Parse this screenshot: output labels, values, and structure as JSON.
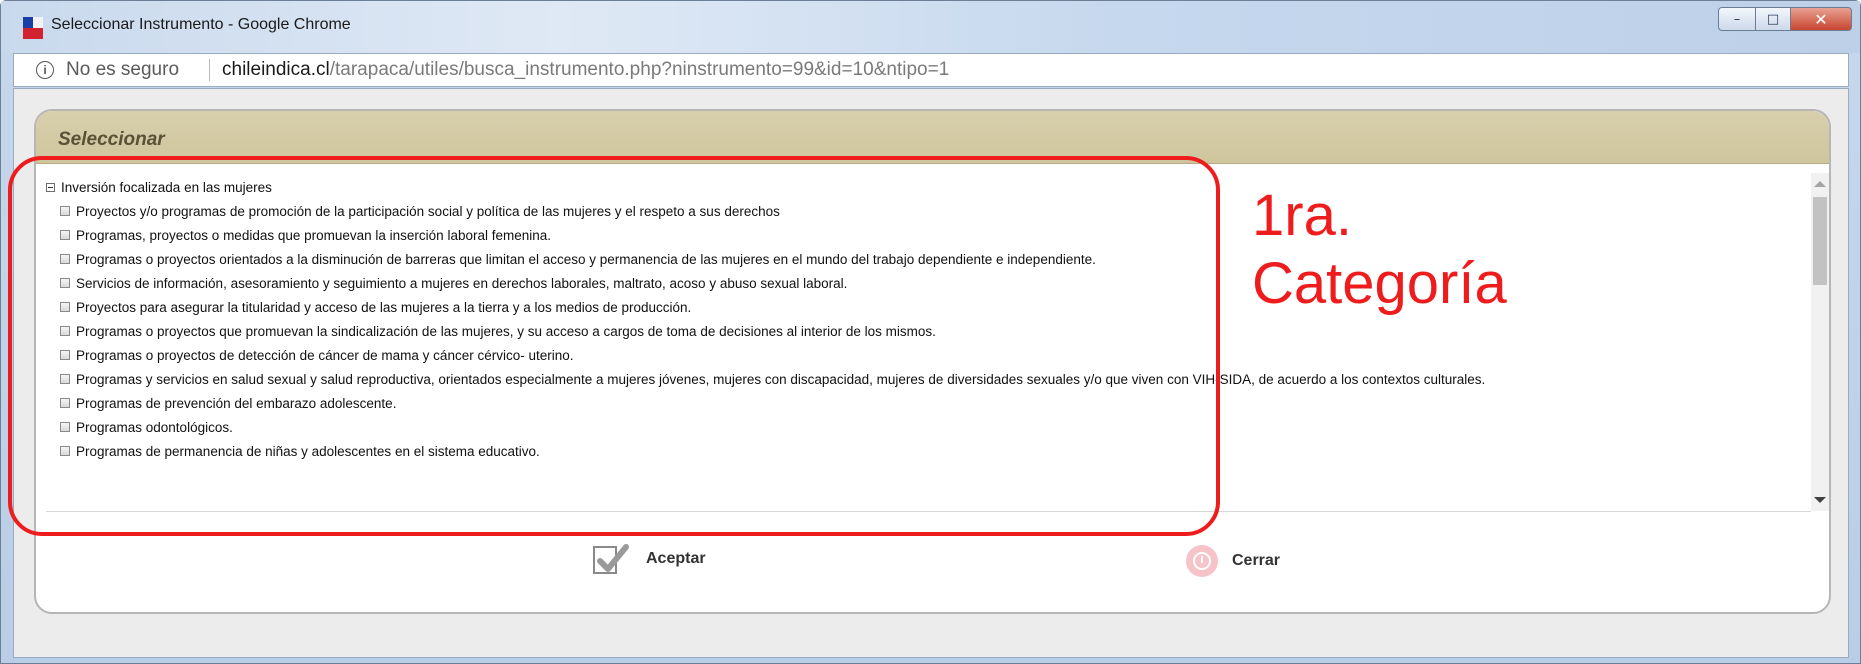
{
  "window": {
    "title": "Seleccionar Instrumento - Google Chrome",
    "controls": {
      "minimize": "–",
      "maximize": "□",
      "close": "✕"
    }
  },
  "address_bar": {
    "security_label": "No es seguro",
    "url_host": "chileindica.cl",
    "url_path": "/tarapaca/utiles/busca_instrumento.php?ninstrumento=99&id=10&ntipo=1"
  },
  "panel": {
    "title": "Seleccionar",
    "tree": {
      "root_label": "Inversión focalizada en las mujeres",
      "items": [
        "Proyectos y/o programas de promoción de la participación social y política de las mujeres y el respeto a sus derechos",
        "Programas, proyectos o medidas que promuevan la inserción laboral femenina.",
        "Programas o proyectos orientados a la disminución de barreras que limitan el acceso y permanencia de las mujeres en el mundo del trabajo dependiente e independiente.",
        "Servicios de información, asesoramiento y seguimiento a mujeres en derechos laborales, maltrato, acoso y abuso sexual laboral.",
        "Proyectos para asegurar la titularidad y acceso de las mujeres a la tierra y a los medios de producción.",
        "Programas o proyectos que promuevan la sindicalización de las mujeres, y su acceso a cargos de toma de decisiones al interior de los mismos.",
        "Programas o proyectos de detección de cáncer de mama y cáncer cérvico- uterino.",
        "Programas y servicios en salud sexual y salud reproductiva, orientados especialmente a mujeres jóvenes, mujeres con discapacidad, mujeres de diversidades sexuales y/o que viven con VIH-SIDA, de acuerdo a los contextos culturales.",
        "Programas de prevención del embarazo adolescente.",
        "Programas odontológicos.",
        "Programas de permanencia de niñas y adolescentes en el sistema educativo."
      ]
    },
    "buttons": {
      "accept": "Aceptar",
      "close": "Cerrar"
    }
  },
  "annotation": {
    "line1": "1ra.",
    "line2": "Categoría",
    "color": "#ee1c1c"
  },
  "colors": {
    "panel_header": "#d4cba4",
    "annotation": "#ee1c1c"
  }
}
